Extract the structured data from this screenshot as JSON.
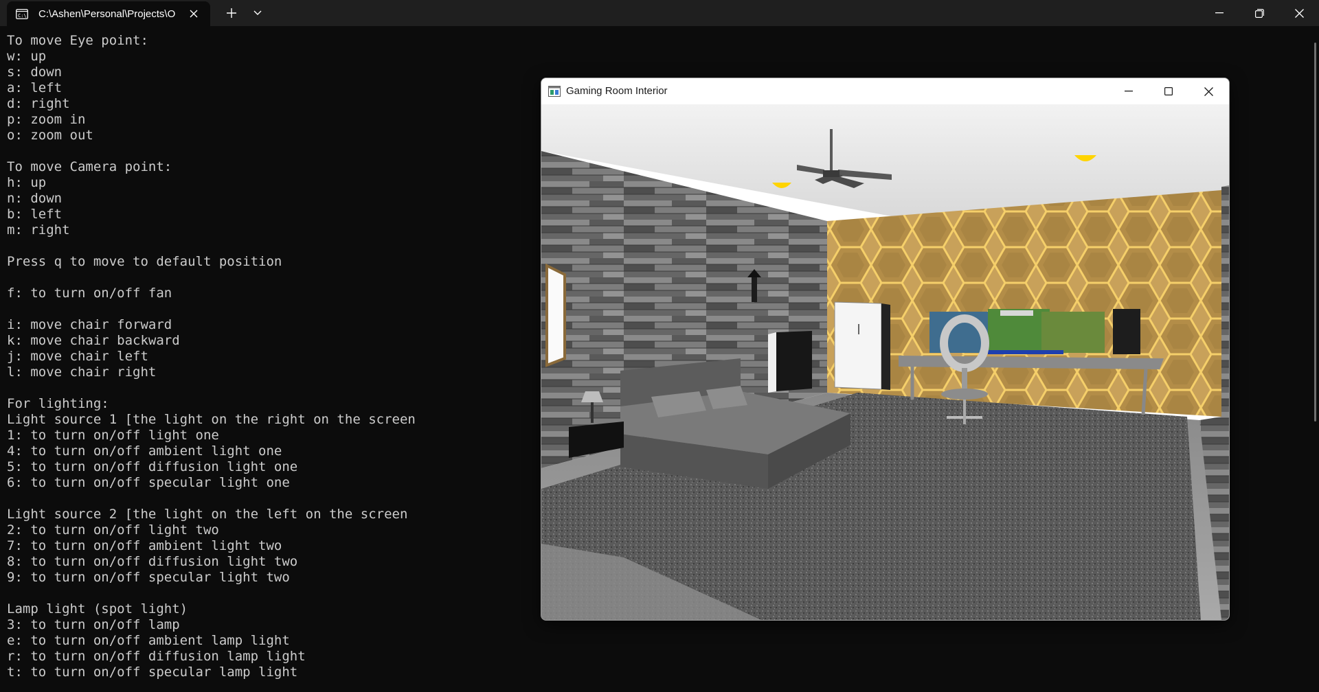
{
  "terminal": {
    "tab_title": "C:\\Ashen\\Personal\\Projects\\O",
    "tab_icon": "terminal-icon",
    "colors": {
      "background": "#0c0c0c",
      "titlebar": "#1f1f1f",
      "text": "#cccccc"
    },
    "lines": [
      "To move Eye point:",
      "w: up",
      "s: down",
      "a: left",
      "d: right",
      "p: zoom in",
      "o: zoom out",
      "",
      "To move Camera point:",
      "h: up",
      "n: down",
      "b: left",
      "m: right",
      "",
      "Press q to move to default position",
      "",
      "f: to turn on/off fan",
      "",
      "i: move chair forward",
      "k: move chair backward",
      "j: move chair left",
      "l: move chair right",
      "",
      "For lighting:",
      "Light source 1 [the light on the right on the screen",
      "1: to turn on/off light one",
      "4: to turn on/off ambient light one",
      "5: to turn on/off diffusion light one",
      "6: to turn on/off specular light one",
      "",
      "Light source 2 [the light on the left on the screen",
      "2: to turn on/off light two",
      "7: to turn on/off ambient light two",
      "8: to turn on/off diffusion light two",
      "9: to turn on/off specular light two",
      "",
      "Lamp light (spot light)",
      "3: to turn on/off lamp",
      "e: to turn on/off ambient lamp light",
      "r: to turn on/off diffusion lamp light",
      "t: to turn on/off specular lamp light"
    ]
  },
  "gl_window": {
    "title": "Gaming Room Interior",
    "icon": "opengl-app-icon",
    "colors": {
      "wall_gold": "#b8964a",
      "light_bulb": "#ffd400",
      "carpet": "#5a5a5a",
      "ceiling": "#e8e8e8"
    }
  }
}
